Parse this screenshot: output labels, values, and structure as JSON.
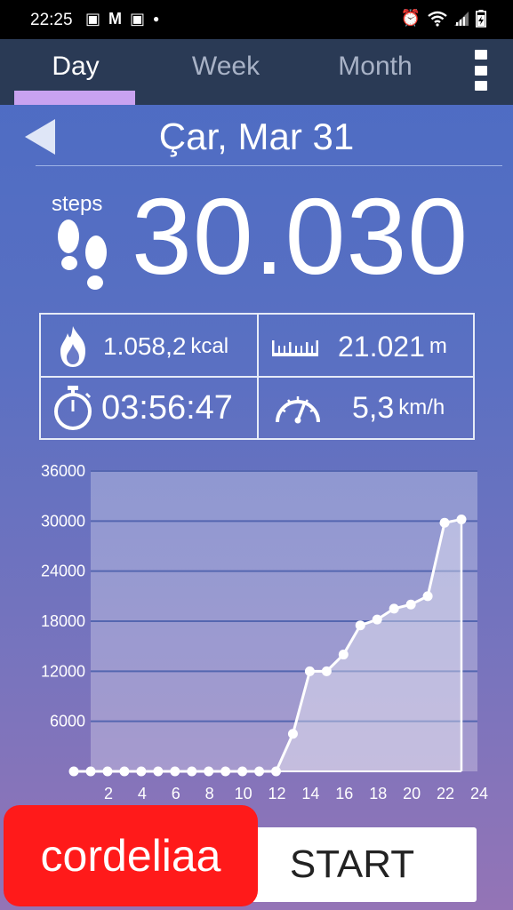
{
  "status_bar": {
    "time": "22:25",
    "notification_icons": [
      "box-icon",
      "gmail-icon",
      "box-icon",
      "dot-icon"
    ],
    "right_icons": [
      "alarm-icon",
      "wifi-icon",
      "signal-icon",
      "battery-charging-icon"
    ]
  },
  "tabs": [
    {
      "label": "Day",
      "active": true
    },
    {
      "label": "Week",
      "active": false
    },
    {
      "label": "Month",
      "active": false
    }
  ],
  "accent_color": "#c9a2f0",
  "date_label": "Çar, Mar 31",
  "steps": {
    "label": "steps",
    "value": "30.030"
  },
  "stats": {
    "calories": {
      "value": "1.058,2",
      "unit": "kcal"
    },
    "distance": {
      "value": "21.021",
      "unit": "m"
    },
    "duration": {
      "value": "03:56:47"
    },
    "speed": {
      "value": "5,3",
      "unit": "km/h"
    }
  },
  "chart_data": {
    "type": "area",
    "x": [
      0,
      1,
      2,
      3,
      4,
      5,
      6,
      7,
      8,
      9,
      10,
      11,
      12,
      13,
      14,
      15,
      16,
      17,
      18,
      19,
      20,
      21,
      22,
      23
    ],
    "y": [
      0,
      0,
      0,
      0,
      0,
      0,
      0,
      0,
      0,
      0,
      0,
      0,
      0,
      4500,
      12000,
      12000,
      14000,
      17500,
      18200,
      19500,
      20000,
      21000,
      29800,
      30200
    ],
    "x_ticks": [
      "2",
      "4",
      "6",
      "8",
      "10",
      "12",
      "14",
      "16",
      "18",
      "20",
      "22",
      "24"
    ],
    "y_ticks": [
      "6000",
      "12000",
      "18000",
      "24000",
      "30000",
      "36000"
    ],
    "xlim": [
      0,
      24
    ],
    "ylim": [
      0,
      36000
    ],
    "grid": true
  },
  "start_button_label": "START",
  "watermark_text": "cordeliaa"
}
